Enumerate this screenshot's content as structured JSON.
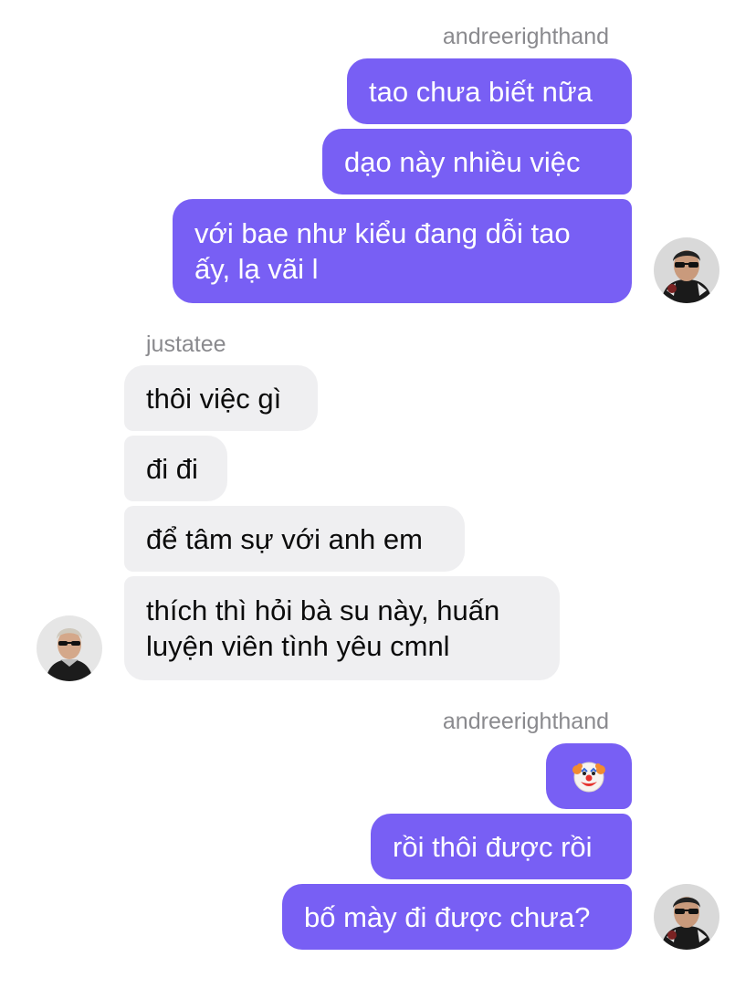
{
  "thread": {
    "group1": {
      "sender": "andreerighthand",
      "messages": [
        "tao chưa biết nữa",
        "dạo này nhiều việc",
        "với bae như kiểu đang dỗi tao ấy, lạ vãi l"
      ]
    },
    "group2": {
      "sender": "justatee",
      "messages": [
        "thôi việc gì",
        "đi đi",
        "để tâm sự với anh em",
        "thích thì hỏi bà su này, huấn luyện viên tình yêu cmnl"
      ]
    },
    "group3": {
      "sender": "andreerighthand",
      "messages": [
        "🤡",
        "rồi thôi được rồi",
        "bố mày đi được chưa?"
      ]
    }
  },
  "colors": {
    "outgoing_bubble": "#785ff4",
    "incoming_bubble": "#efeff1",
    "sender_name": "#8a8a8e"
  },
  "icons": {
    "clown_emoji": "clown-face-icon",
    "avatar_andree": "avatar-andreerighthand",
    "avatar_justatee": "avatar-justatee"
  }
}
